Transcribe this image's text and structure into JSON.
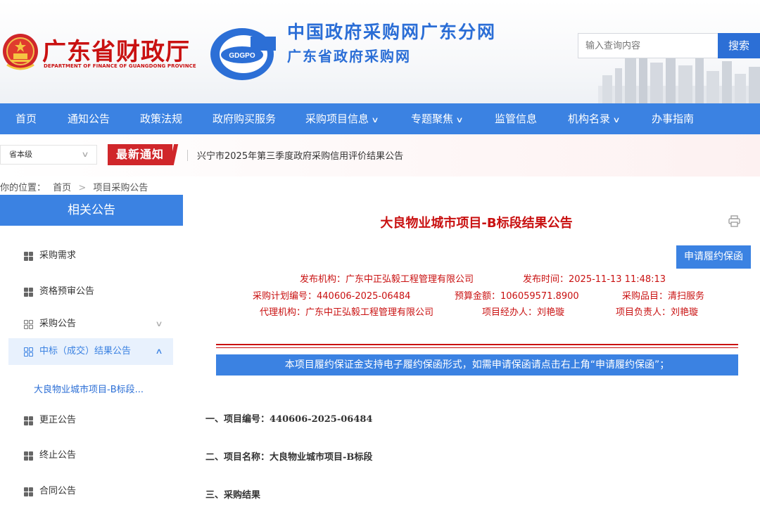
{
  "header": {
    "dept_name": "广东省财政厅",
    "dept_name_en": "DEPARTMENT OF FINANCE OF GUANGDONG PROVINCE",
    "logo_text": "GDGPO",
    "site_title_1": "中国政府采购网广东分网",
    "site_title_2": "广东省政府采购网",
    "search_placeholder": "输入查询内容",
    "search_button": "搜索"
  },
  "nav": [
    {
      "label": "首页"
    },
    {
      "label": "通知公告"
    },
    {
      "label": "政策法规"
    },
    {
      "label": "政府购买服务"
    },
    {
      "label": "采购项目信息"
    },
    {
      "label": "专题聚焦"
    },
    {
      "label": "监管信息"
    },
    {
      "label": "机构名录"
    },
    {
      "label": "办事指南"
    }
  ],
  "notice": {
    "level": "省本级",
    "badge": "最新通知",
    "text": "兴宁市2025年第三季度政府采购信用评价结果公告"
  },
  "breadcrumb": {
    "prefix": "你的位置：",
    "home": "首页",
    "current": "项目采购公告"
  },
  "sidebar": {
    "title": "相关公告",
    "items": [
      {
        "label": "采购需求"
      },
      {
        "label": "资格预审公告"
      },
      {
        "label": "采购公告"
      },
      {
        "label": "中标（成交）结果公告"
      },
      {
        "label": "大良物业城市项目-B标段..."
      },
      {
        "label": "更正公告"
      },
      {
        "label": "终止公告"
      },
      {
        "label": "合同公告"
      }
    ]
  },
  "article": {
    "title": "大良物业城市项目-B标段结果公告",
    "guarantee_button": "申请履约保函",
    "publisher": "发布机构：广东中正弘毅工程管理有限公司",
    "publish_time": "发布时间：2025-11-13 11:48:13",
    "plan_no": "采购计划编号：440606-2025-06484",
    "budget": "预算金额：106059571.8900",
    "category": "采购品目：清扫服务",
    "agency": "代理机构：广东中正弘毅工程管理有限公司",
    "handler": "项目经办人：刘艳璇",
    "manager": "项目负责人：刘艳璇",
    "banner": "本项目履约保证金支持电子履约保函形式，如需申请保函请点击右上角“申请履约保函”；",
    "sections": [
      {
        "text": "一、项目编号：440606-2025-06484"
      },
      {
        "text": "二、项目名称：大良物业城市项目-B标段"
      },
      {
        "text": "三、采购结果"
      }
    ]
  },
  "colors": {
    "brand_blue": "#3b82e2",
    "red": "#c91111"
  },
  "icons": [
    "emblem-icon",
    "gdgpo-logo-icon",
    "chevron-down-icon",
    "chevron-up-icon",
    "grid-icon",
    "print-icon"
  ]
}
